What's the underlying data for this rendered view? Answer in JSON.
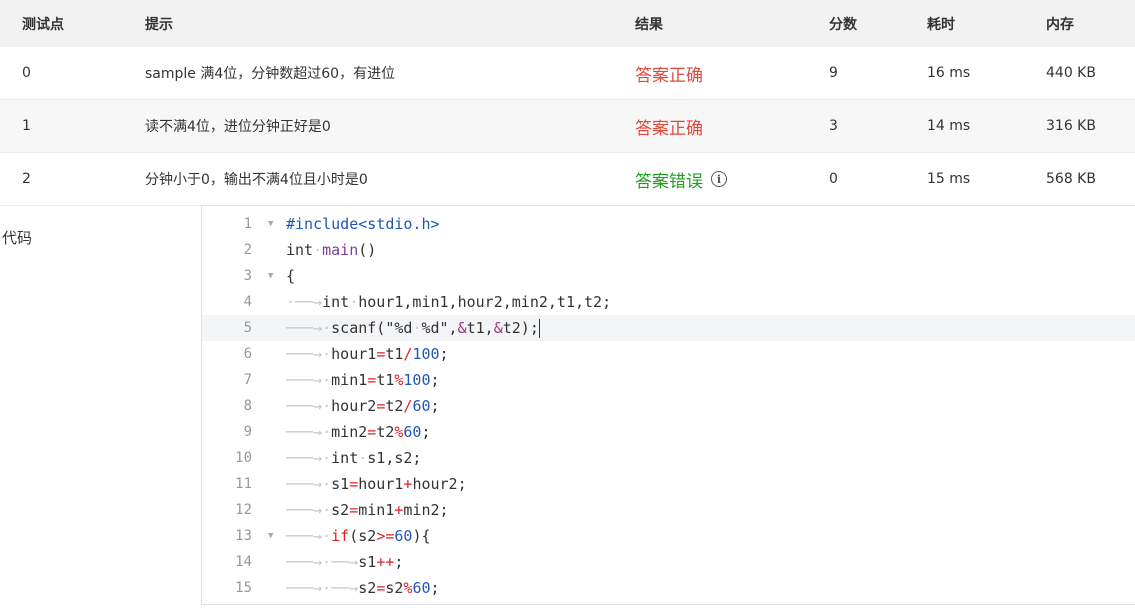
{
  "table": {
    "headers": [
      "测试点",
      "提示",
      "结果",
      "分数",
      "耗时",
      "内存"
    ],
    "rows": [
      {
        "id": "0",
        "hint": "sample 满4位，分钟数超过60，有进位",
        "result": "答案正确",
        "score": "9",
        "time": "16 ms",
        "memory": "440 KB",
        "status": "ok"
      },
      {
        "id": "1",
        "hint": "读不满4位，进位分钟正好是0",
        "result": "答案正确",
        "score": "3",
        "time": "14 ms",
        "memory": "316 KB",
        "status": "ok"
      },
      {
        "id": "2",
        "hint": "分钟小于0，输出不满4位且小时是0",
        "result": "答案错误",
        "score": "0",
        "time": "15 ms",
        "memory": "568 KB",
        "status": "wrong"
      }
    ]
  },
  "code_label": "代码",
  "colors": {
    "correct": "#e3493a",
    "wrong": "#1e9e1e"
  },
  "icons": {
    "result_info": "info-circle-icon",
    "fold": "fold-arrow-icon"
  },
  "code_lines": [
    {
      "num": "1",
      "fold": true,
      "tokens": [
        [
          "pp",
          "#include<stdio.h>"
        ]
      ]
    },
    {
      "num": "2",
      "fold": false,
      "tokens": [
        [
          "kw",
          "int"
        ],
        [
          "ws",
          "·"
        ],
        [
          "fn",
          "main"
        ],
        [
          "t",
          "()"
        ]
      ]
    },
    {
      "num": "3",
      "fold": true,
      "tokens": [
        [
          "t",
          "{"
        ]
      ]
    },
    {
      "num": "4",
      "fold": false,
      "tokens": [
        [
          "ws",
          "·──→"
        ],
        [
          "kw",
          "int"
        ],
        [
          "ws",
          "·"
        ],
        [
          "t",
          "hour1,min1,hour2,min2,t1,t2;"
        ]
      ]
    },
    {
      "num": "5",
      "fold": false,
      "active": true,
      "tokens": [
        [
          "ws",
          "───→·"
        ],
        [
          "t",
          "scanf(\"%d"
        ],
        [
          "ws",
          "·"
        ],
        [
          "t",
          "%d\","
        ],
        [
          "amp",
          "&"
        ],
        [
          "t",
          "t1,"
        ],
        [
          "amp",
          "&"
        ],
        [
          "t",
          "t2);"
        ],
        [
          "cursor",
          ""
        ]
      ]
    },
    {
      "num": "6",
      "fold": false,
      "tokens": [
        [
          "ws",
          "───→·"
        ],
        [
          "t",
          "hour1"
        ],
        [
          "op",
          "="
        ],
        [
          "t",
          "t1"
        ],
        [
          "op",
          "/"
        ],
        [
          "num",
          "100"
        ],
        [
          "t",
          ";"
        ]
      ]
    },
    {
      "num": "7",
      "fold": false,
      "tokens": [
        [
          "ws",
          "───→·"
        ],
        [
          "t",
          "min1"
        ],
        [
          "op",
          "="
        ],
        [
          "t",
          "t1"
        ],
        [
          "op",
          "%"
        ],
        [
          "num",
          "100"
        ],
        [
          "t",
          ";"
        ]
      ]
    },
    {
      "num": "8",
      "fold": false,
      "tokens": [
        [
          "ws",
          "───→·"
        ],
        [
          "t",
          "hour2"
        ],
        [
          "op",
          "="
        ],
        [
          "t",
          "t2"
        ],
        [
          "op",
          "/"
        ],
        [
          "num",
          "60"
        ],
        [
          "t",
          ";"
        ]
      ]
    },
    {
      "num": "9",
      "fold": false,
      "tokens": [
        [
          "ws",
          "───→·"
        ],
        [
          "t",
          "min2"
        ],
        [
          "op",
          "="
        ],
        [
          "t",
          "t2"
        ],
        [
          "op",
          "%"
        ],
        [
          "num",
          "60"
        ],
        [
          "t",
          ";"
        ]
      ]
    },
    {
      "num": "10",
      "fold": false,
      "tokens": [
        [
          "ws",
          "───→·"
        ],
        [
          "kw",
          "int"
        ],
        [
          "ws",
          "·"
        ],
        [
          "t",
          "s1,s2;"
        ]
      ]
    },
    {
      "num": "11",
      "fold": false,
      "tokens": [
        [
          "ws",
          "───→·"
        ],
        [
          "t",
          "s1"
        ],
        [
          "op",
          "="
        ],
        [
          "t",
          "hour1"
        ],
        [
          "op",
          "+"
        ],
        [
          "t",
          "hour2;"
        ]
      ]
    },
    {
      "num": "12",
      "fold": false,
      "tokens": [
        [
          "ws",
          "───→·"
        ],
        [
          "t",
          "s2"
        ],
        [
          "op",
          "="
        ],
        [
          "t",
          "min1"
        ],
        [
          "op",
          "+"
        ],
        [
          "t",
          "min2;"
        ]
      ]
    },
    {
      "num": "13",
      "fold": true,
      "tokens": [
        [
          "ws",
          "───→·"
        ],
        [
          "op",
          "if"
        ],
        [
          "t",
          "(s2"
        ],
        [
          "op",
          ">="
        ],
        [
          "num",
          "60"
        ],
        [
          "t",
          "){"
        ]
      ]
    },
    {
      "num": "14",
      "fold": false,
      "tokens": [
        [
          "ws",
          "───→·──→"
        ],
        [
          "t",
          "s1"
        ],
        [
          "op",
          "++"
        ],
        [
          "t",
          ";"
        ]
      ]
    },
    {
      "num": "15",
      "fold": false,
      "tokens": [
        [
          "ws",
          "───→·──→"
        ],
        [
          "t",
          "s2"
        ],
        [
          "op",
          "="
        ],
        [
          "t",
          "s2"
        ],
        [
          "op",
          "%"
        ],
        [
          "num",
          "60"
        ],
        [
          "t",
          ";"
        ]
      ]
    }
  ]
}
